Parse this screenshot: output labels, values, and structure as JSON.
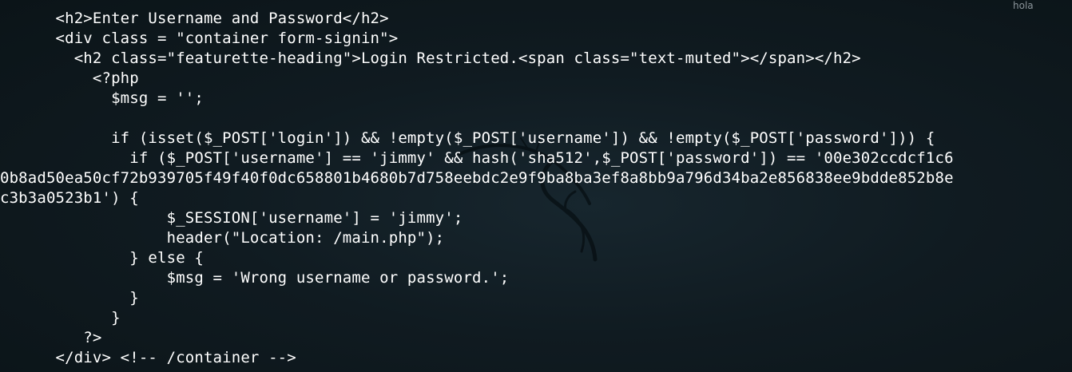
{
  "window": {
    "corner_label": "hola",
    "logo_icon": "kali-dragon-icon"
  },
  "code": {
    "lines": [
      "      <h2>Enter Username and Password</h2>",
      "      <div class = \"container form-signin\">",
      "        <h2 class=\"featurette-heading\">Login Restricted.<span class=\"text-muted\"></span></h2>",
      "          <?php",
      "            $msg = '';",
      "",
      "            if (isset($_POST['login']) && !empty($_POST['username']) && !empty($_POST['password'])) {",
      "              if ($_POST['username'] == 'jimmy' && hash('sha512',$_POST['password']) == '00e302ccdcf1c6",
      "0b8ad50ea50cf72b939705f49f40f0dc658801b4680b7d758eebdc2e9f9ba8ba3ef8a8bb9a796d34ba2e856838ee9bdde852b8e",
      "c3b3a0523b1') {",
      "                  $_SESSION['username'] = 'jimmy';",
      "                  header(\"Location: /main.php\");",
      "              } else {",
      "                  $msg = 'Wrong username or password.';",
      "              }",
      "            }",
      "         ?>",
      "      </div> <!-- /container -->"
    ]
  }
}
